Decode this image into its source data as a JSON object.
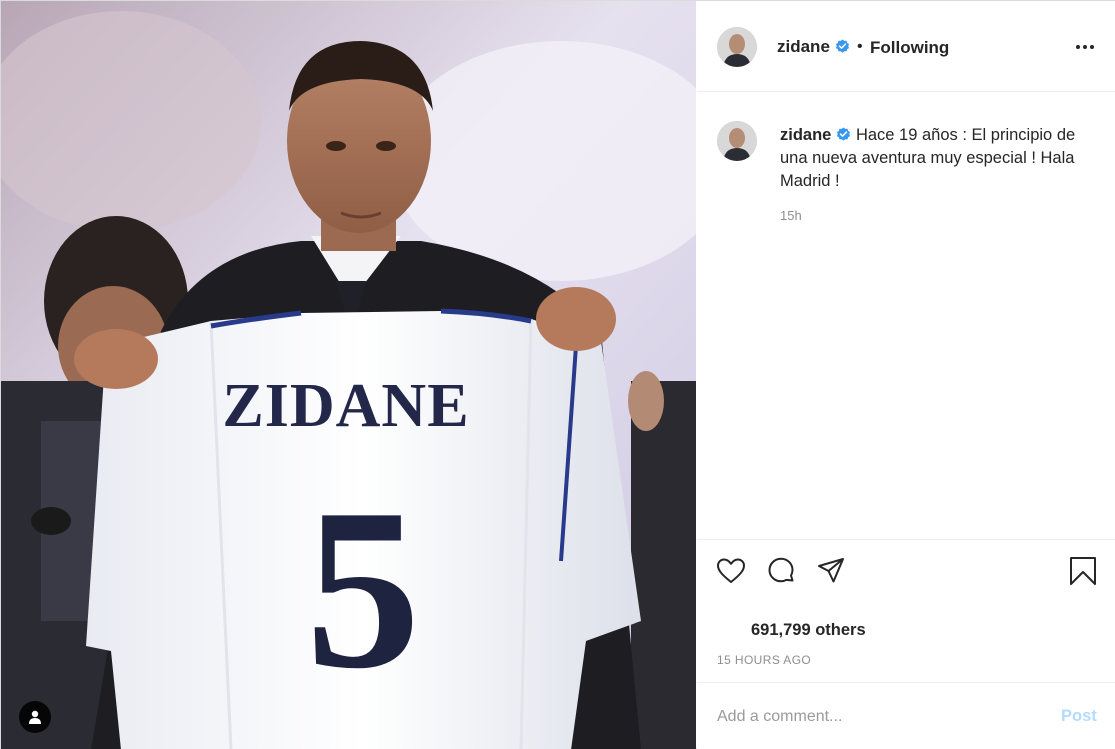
{
  "header": {
    "username": "zidane",
    "separator": "•",
    "follow_status": "Following",
    "verified_icon": "verified-badge-icon",
    "more_icon": "more-options-icon"
  },
  "photo": {
    "jersey_name": "ZIDANE",
    "jersey_number": "5",
    "user_tag_icon": "user-tag-icon"
  },
  "caption": {
    "username": "zidane",
    "text": "Hace 19 años : El principio de una nueva aventura muy especial ! Hala Madrid !",
    "time": "15h"
  },
  "actions": {
    "like_icon": "heart-icon",
    "comment_icon": "comment-icon",
    "share_icon": "share-icon",
    "save_icon": "bookmark-icon"
  },
  "likes": {
    "text": "691,799 others"
  },
  "post_date": "15 HOURS AGO",
  "comment": {
    "placeholder": "Add a comment...",
    "post_label": "Post"
  },
  "colors": {
    "accent_blue": "#0095f6",
    "post_disabled": "#b3dbff",
    "verified": "#3897f0",
    "muted_text": "#8e8e8e"
  }
}
